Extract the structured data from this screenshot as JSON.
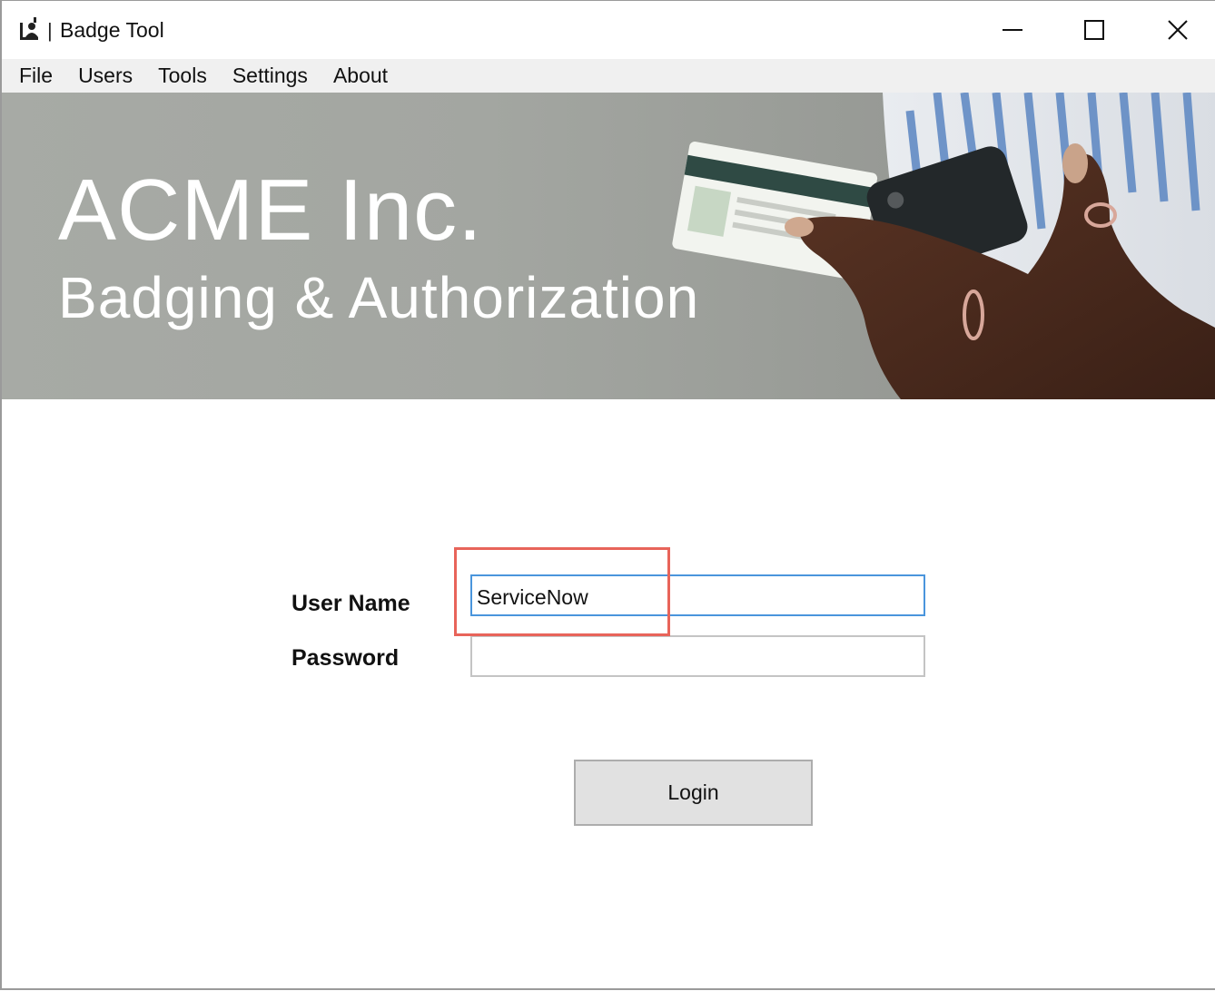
{
  "window": {
    "title": "Badge Tool",
    "title_separator": "|",
    "controls": {
      "minimize_icon": "minimize-icon",
      "maximize_icon": "maximize-icon",
      "close_icon": "close-icon"
    }
  },
  "menu": {
    "items": [
      {
        "label": "File"
      },
      {
        "label": "Users"
      },
      {
        "label": "Tools"
      },
      {
        "label": "Settings"
      },
      {
        "label": "About"
      }
    ]
  },
  "banner": {
    "title": "ACME Inc.",
    "subtitle": "Badging & Authorization"
  },
  "login_form": {
    "username_label": "User Name",
    "username_value": "ServiceNow",
    "password_label": "Password",
    "password_value": "",
    "login_button": "Login"
  },
  "colors": {
    "focus_border": "#4a95dc",
    "highlight_annotation": "#e8645a",
    "banner_bg": "#a3a6a1",
    "button_bg": "#e1e1e1"
  }
}
